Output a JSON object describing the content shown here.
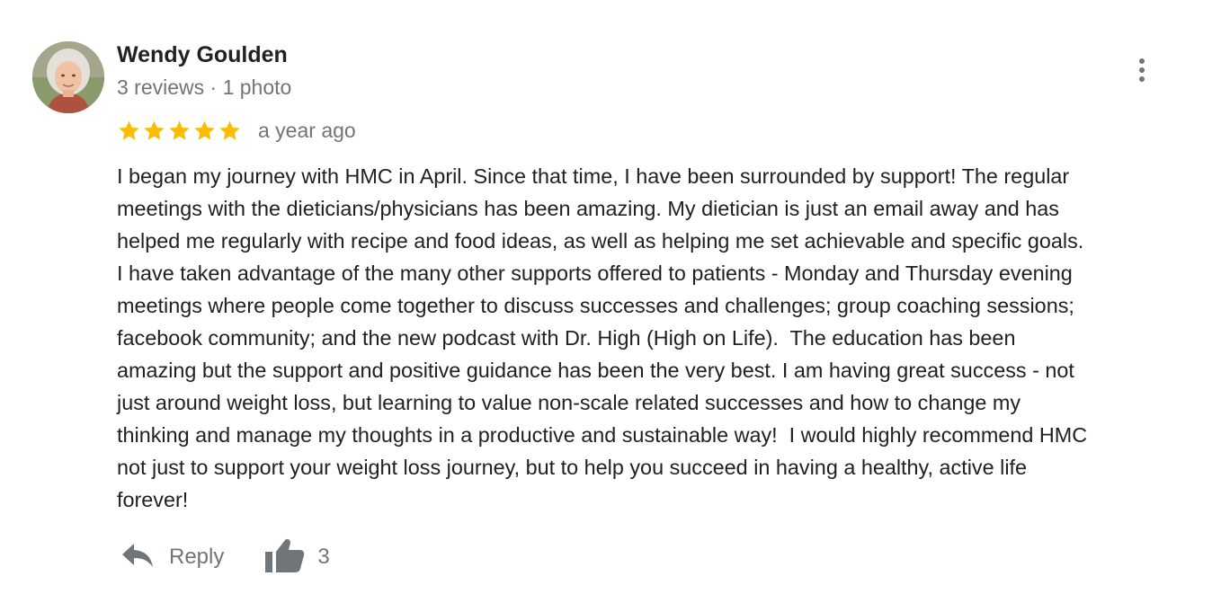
{
  "review": {
    "author": "Wendy Goulden",
    "meta": "3 reviews · 1 photo",
    "rating": 5,
    "rating_max": 5,
    "time": "a year ago",
    "star_color": "#fbbc04",
    "body_lines": [
      "I began my journey with HMC in April. Since that time, I have been surrounded by support! The regular",
      "meetings with the dieticians/physicians has been amazing. My dietician is just an email away and has",
      "helped me regularly with recipe and food ideas, as well as helping me set achievable and specific goals.",
      "I have taken advantage of the many other supports offered to patients - Monday and Thursday evening",
      "meetings where people come together to discuss successes and challenges; group coaching sessions;",
      "facebook community; and the new podcast with Dr. High (High on Life).  The education has been",
      "amazing but the support and positive guidance has been the very best. I am having great success - not",
      "just around weight loss, but learning to value non-scale related successes and how to change my",
      "thinking and manage my thoughts in a productive and sustainable way!  I would highly recommend HMC",
      "not just to support your weight loss journey, but to help you succeed in having a healthy, active life",
      "forever!"
    ]
  },
  "actions": {
    "reply_label": "Reply",
    "reply_icon": "reply-icon",
    "like_icon": "thumbs-up-icon",
    "like_count": "3"
  },
  "menu_icon": "more-vertical-icon",
  "colors": {
    "text": "#202124",
    "secondary": "#70757a",
    "icon": "#70757a",
    "star": "#fbbc04"
  }
}
